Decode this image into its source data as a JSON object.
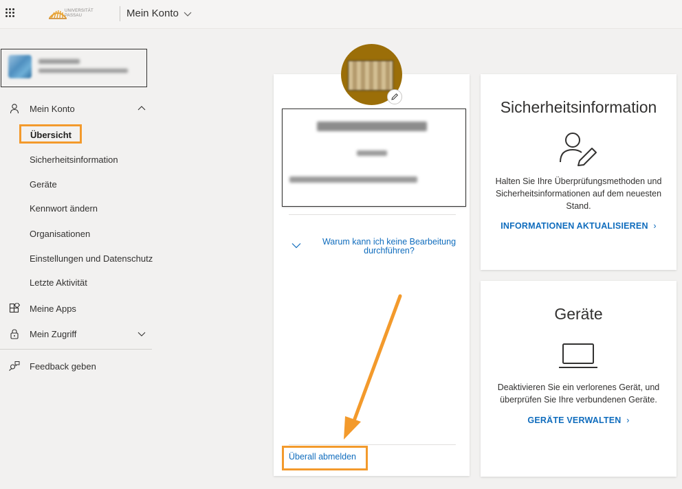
{
  "header": {
    "logo_text_line1": "UNIVERSITÄT",
    "logo_text_line2": "PASSAU",
    "app_title": "Mein Konto",
    "icons": [
      "app-launcher-icon",
      "chevron-down-icon"
    ]
  },
  "sidebar": {
    "items": [
      {
        "label": "Mein Konto",
        "icon": "person-icon",
        "chevron": "up"
      },
      {
        "label": "Übersicht",
        "selected": true
      },
      {
        "label": "Sicherheitsinformation"
      },
      {
        "label": "Geräte"
      },
      {
        "label": "Kennwort ändern"
      },
      {
        "label": "Organisationen"
      },
      {
        "label": "Einstellungen und Datenschutz"
      },
      {
        "label": "Letzte Aktivität"
      },
      {
        "label": "Meine Apps",
        "icon": "apps-icon"
      },
      {
        "label": "Mein Zugriff",
        "icon": "lock-icon",
        "chevron": "down"
      },
      {
        "label": "Feedback geben",
        "icon": "feedback-icon"
      }
    ]
  },
  "center_card": {
    "why_text": "Warum kann ich keine Bearbeitung durchführen?",
    "signout_label": "Überall abmelden"
  },
  "security_card": {
    "title": "Sicherheitsinformation",
    "description": "Halten Sie Ihre Überprüfungsmethoden und Sicherheitsinformationen auf dem neuesten Stand.",
    "link": "INFORMATIONEN AKTUALISIEREN",
    "icon": "person-edit-icon"
  },
  "devices_card": {
    "title": "Geräte",
    "description": "Deaktivieren Sie ein verlorenes Gerät, und überprüfen Sie Ihre verbundenen Geräte.",
    "link": "GERÄTE VERWALTEN",
    "icon": "laptop-icon"
  },
  "colors": {
    "highlight": "#f39a2c",
    "link": "#0f6cbd",
    "avatar": "#9b6e08"
  }
}
